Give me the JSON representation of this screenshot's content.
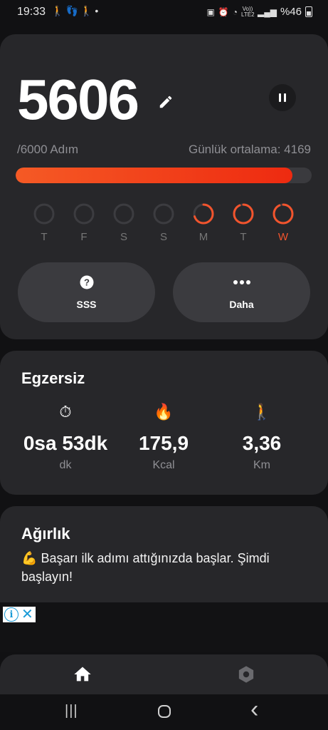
{
  "status_bar": {
    "time": "19:33",
    "left_icons": [
      "walking-icon",
      "footsteps-icon",
      "walking-icon",
      "dot-icon"
    ],
    "right_icons": [
      "screenshot-icon",
      "alarm-icon",
      "wifi-icon",
      "volte-icon",
      "signal-icon"
    ],
    "volte_label": "Vo)) LTE2",
    "battery": "%46"
  },
  "steps": {
    "count": "5606",
    "goal_label": "/6000 Adım",
    "average_label": "Günlük ortalama: 4169",
    "progress_fraction": 0.934,
    "accent_color": "#f2542d"
  },
  "week": {
    "days": [
      {
        "label": "T",
        "progress": 0
      },
      {
        "label": "F",
        "progress": 0
      },
      {
        "label": "S",
        "progress": 0
      },
      {
        "label": "S",
        "progress": 0
      },
      {
        "label": "M",
        "progress": 0.7
      },
      {
        "label": "T",
        "progress": 0.93
      },
      {
        "label": "W",
        "progress": 0.93,
        "today": true
      }
    ]
  },
  "actions": {
    "faq_label": "SSS",
    "more_label": "Daha"
  },
  "exercise": {
    "title": "Egzersiz",
    "stats": [
      {
        "icon": "⏱",
        "icon_name": "stopwatch-icon",
        "value": "0sa 53dk",
        "unit": "dk"
      },
      {
        "icon": "🔥",
        "icon_name": "fire-icon",
        "value": "175,9",
        "unit": "Kcal"
      },
      {
        "icon": "🚶",
        "icon_name": "walker-icon",
        "value": "3,36",
        "unit": "Km"
      }
    ]
  },
  "weight": {
    "title": "Ağırlık",
    "icon": "💪",
    "message": "Başarı ilk adımı attığınızda başlar. Şimdi başlayın!"
  },
  "ad": {
    "info_glyph": "i",
    "close_glyph": "✕"
  },
  "system_nav": {
    "recents": "|||",
    "back": "‹"
  }
}
